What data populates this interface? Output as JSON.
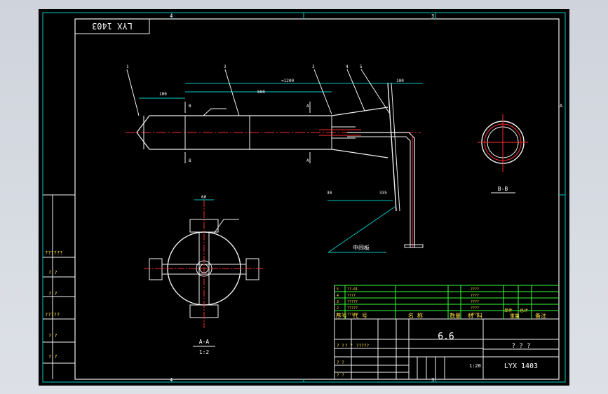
{
  "drawing": {
    "title_block_code": "LYX 1403",
    "corner_code_rotated": "LYX 1403",
    "zone_labels": {
      "top_a": "4",
      "top_b": "3",
      "right_a": "A",
      "bottom_a": "4",
      "bottom_b": "3"
    },
    "section_aa": {
      "label": "A-A",
      "scale": "1:2"
    },
    "section_bb": {
      "label": "B-B"
    },
    "note_flange": "中间板",
    "dims": {
      "d100_left": "100",
      "d600": "600",
      "d1200": "≈1200",
      "d100_right": "100",
      "d30": "30",
      "d335": "335",
      "d60": "60"
    },
    "balloons": [
      "1",
      "2",
      "3",
      "4",
      "5"
    ],
    "section_marks": [
      "B",
      "B",
      "A",
      "A"
    ]
  },
  "title_block": {
    "header_row": [
      "序号",
      "代 号",
      "名 称",
      "数量",
      "材 料",
      "单件",
      "总计",
      "备注"
    ],
    "header_weight": "重量",
    "scale_value": "6.6",
    "sheet_value": "1:20",
    "name_value": "? ? ?",
    "code_value": "LYX 1403",
    "left_labels": [
      "??????",
      "? ?",
      "? ?",
      "?????",
      "? ?",
      "? ?"
    ],
    "sign_rows": [
      "? ?",
      "? ?",
      "?????",
      "? ?",
      "? ?"
    ],
    "parts": [
      {
        "no": "5",
        "code": "??-01",
        "mat": "????"
      },
      {
        "no": "4",
        "code": "????",
        "mat": "????"
      },
      {
        "no": "3",
        "code": "?????",
        "mat": "????"
      },
      {
        "no": "2",
        "code": "?????",
        "mat": "????"
      },
      {
        "no": "1",
        "code": "?????",
        "mat": "????"
      }
    ]
  }
}
